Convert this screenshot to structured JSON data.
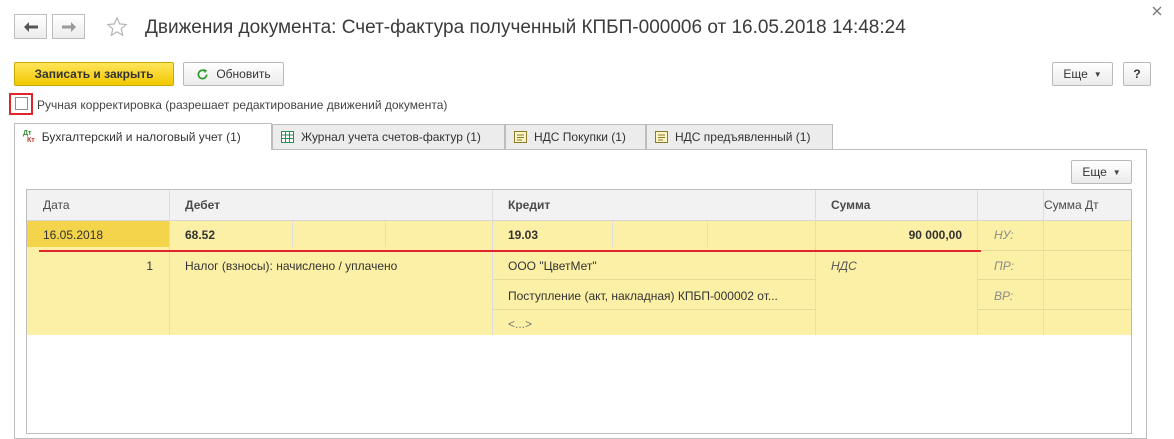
{
  "window": {
    "title": "Движения документа: Счет-фактура полученный КПБП-000006 от 16.05.2018 14:48:24"
  },
  "toolbar": {
    "save_close": "Записать и закрыть",
    "refresh": "Обновить",
    "more": "Еще",
    "help": "?"
  },
  "manual_edit": {
    "label": "Ручная корректировка (разрешает редактирование движений документа)",
    "checked": false
  },
  "tabs": [
    {
      "label": "Бухгалтерский и налоговый учет (1)",
      "icon": "dt-kt-icon",
      "active": true
    },
    {
      "label": "Журнал учета счетов-фактур (1)",
      "icon": "table-icon",
      "active": false
    },
    {
      "label": "НДС Покупки (1)",
      "icon": "register-icon",
      "active": false
    },
    {
      "label": "НДС предъявленный (1)",
      "icon": "register-icon",
      "active": false
    }
  ],
  "tab_icon_text": {
    "dt": "Дт",
    "kt": "Кт"
  },
  "grid": {
    "more": "Еще",
    "columns": [
      "Дата",
      "Дебет",
      "Кредит",
      "Сумма",
      "Сумма Дт"
    ],
    "record": {
      "date": "16.05.2018",
      "line_number": "1",
      "debit_account": "68.52",
      "debit_subconto_1": "Налог (взносы): начислено / уплачено",
      "credit_account": "19.03",
      "credit_subconto_1": "ООО \"ЦветМет\"",
      "credit_subconto_2": "Поступление (акт, накладная) КПБП-000002 от...",
      "credit_subconto_3": "<...>",
      "amount": "90 000,00",
      "amount_kind": "НДС",
      "tax_labels": [
        "НУ:",
        "ПР:",
        "ВР:"
      ]
    }
  },
  "colors": {
    "primary_button": "#f2c800",
    "selected_row": "#fbf0a6",
    "selected_cell": "#f4d44a",
    "highlight_red": "#e0262b"
  }
}
